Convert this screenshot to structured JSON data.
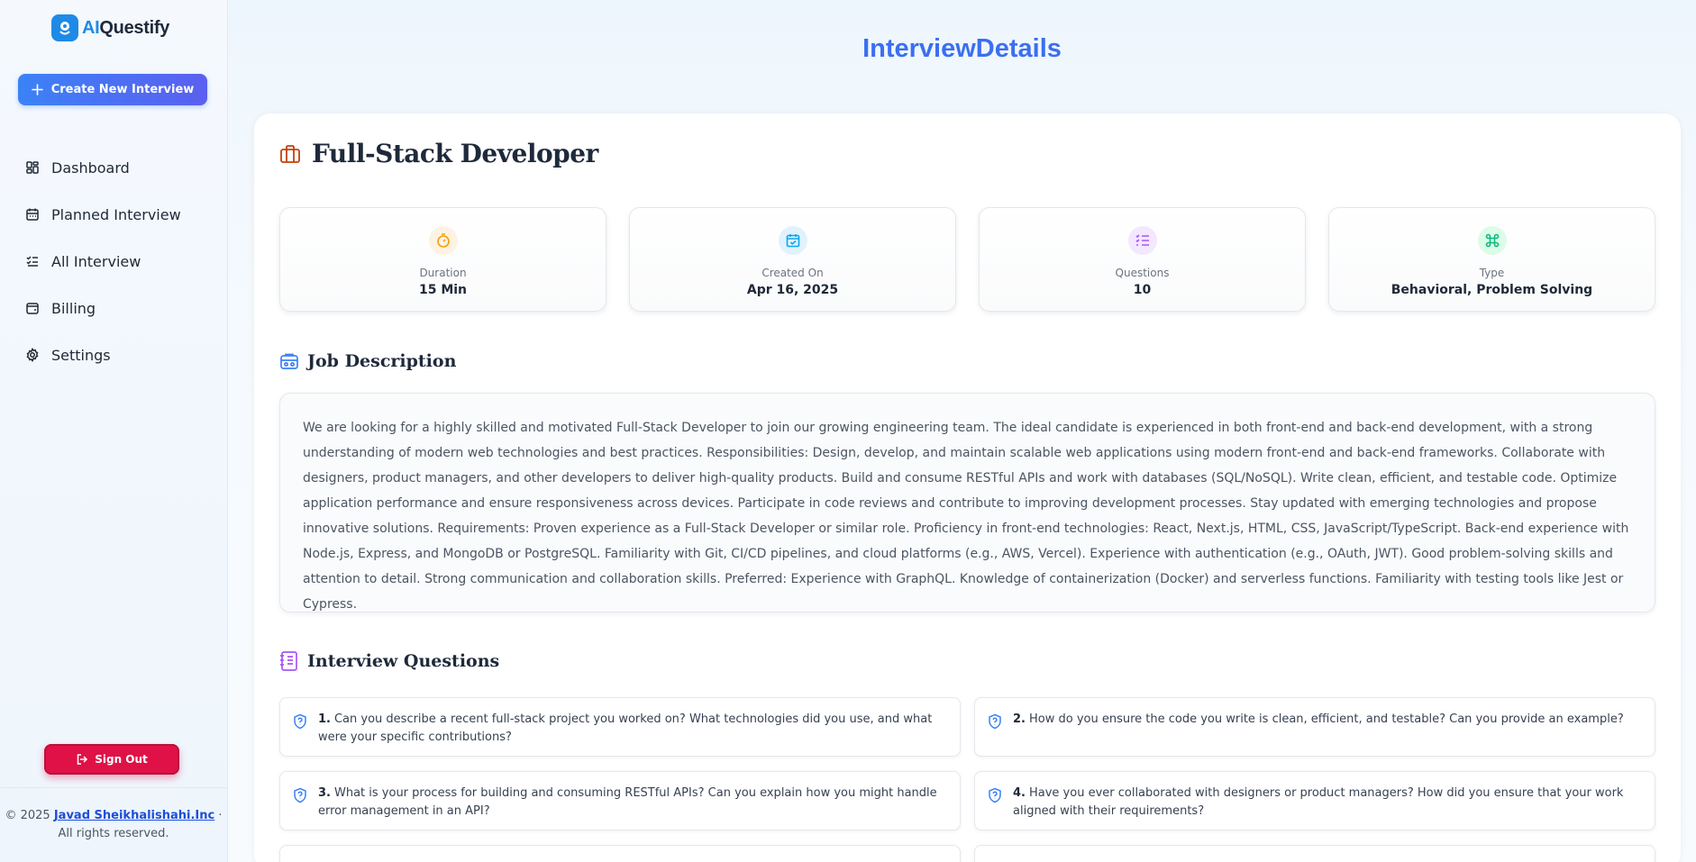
{
  "brand": {
    "ai": "AI",
    "rest": "Questify"
  },
  "sidebar": {
    "create_label": "Create New Interview",
    "items": [
      {
        "label": "Dashboard",
        "icon": "dashboard-icon"
      },
      {
        "label": "Planned Interview",
        "icon": "calendar-icon"
      },
      {
        "label": "All Interview",
        "icon": "list-check-icon"
      },
      {
        "label": "Billing",
        "icon": "wallet-icon"
      },
      {
        "label": "Settings",
        "icon": "gear-icon"
      }
    ],
    "signout_label": "Sign Out",
    "copyright_prefix": "© 2025",
    "copyright_link": "Javad Sheikhalishahi.Inc",
    "copyright_sep": "·",
    "rights": "All rights reserved."
  },
  "page": {
    "title": "InterviewDetails"
  },
  "interview": {
    "role": "Full-Stack Developer",
    "stats": [
      {
        "label": "Duration",
        "value": "15 Min",
        "icon": "timer-icon",
        "color": "#f59e0b"
      },
      {
        "label": "Created On",
        "value": "Apr 16, 2025",
        "icon": "calendar-check-icon",
        "color": "#0ea5e9"
      },
      {
        "label": "Questions",
        "value": "10",
        "icon": "list-icon",
        "color": "#a855f7"
      },
      {
        "label": "Type",
        "value": "Behavioral, Problem Solving",
        "icon": "command-icon",
        "color": "#10b981"
      }
    ],
    "job_description_heading": "Job Description",
    "job_description": "We are looking for a highly skilled and motivated Full-Stack Developer to join our growing engineering team. The ideal candidate is experienced in both front-end and back-end development, with a strong understanding of modern web technologies and best practices. Responsibilities: Design, develop, and maintain scalable web applications using modern front-end and back-end frameworks. Collaborate with designers, product managers, and other developers to deliver high-quality products. Build and consume RESTful APIs and work with databases (SQL/NoSQL). Write clean, efficient, and testable code. Optimize application performance and ensure responsiveness across devices. Participate in code reviews and contribute to improving development processes. Stay updated with emerging technologies and propose innovative solutions. Requirements: Proven experience as a Full-Stack Developer or similar role. Proficiency in front-end technologies: React, Next.js, HTML, CSS, JavaScript/TypeScript. Back-end experience with Node.js, Express, and MongoDB or PostgreSQL. Familiarity with Git, CI/CD pipelines, and cloud platforms (e.g., AWS, Vercel). Experience with authentication (e.g., OAuth, JWT). Good problem-solving skills and attention to detail. Strong communication and collaboration skills. Preferred: Experience with GraphQL. Knowledge of containerization (Docker) and serverless functions. Familiarity with testing tools like Jest or Cypress.",
    "questions_heading": "Interview Questions",
    "questions": [
      {
        "num": "1.",
        "text": "Can you describe a recent full-stack project you worked on? What technologies did you use, and what were your specific contributions?"
      },
      {
        "num": "2.",
        "text": "How do you ensure the code you write is clean, efficient, and testable? Can you provide an example?"
      },
      {
        "num": "3.",
        "text": "What is your process for building and consuming RESTful APIs? Can you explain how you might handle error management in an API?"
      },
      {
        "num": "4.",
        "text": "Have you ever collaborated with designers or product managers? How did you ensure that your work aligned with their requirements?"
      }
    ]
  }
}
